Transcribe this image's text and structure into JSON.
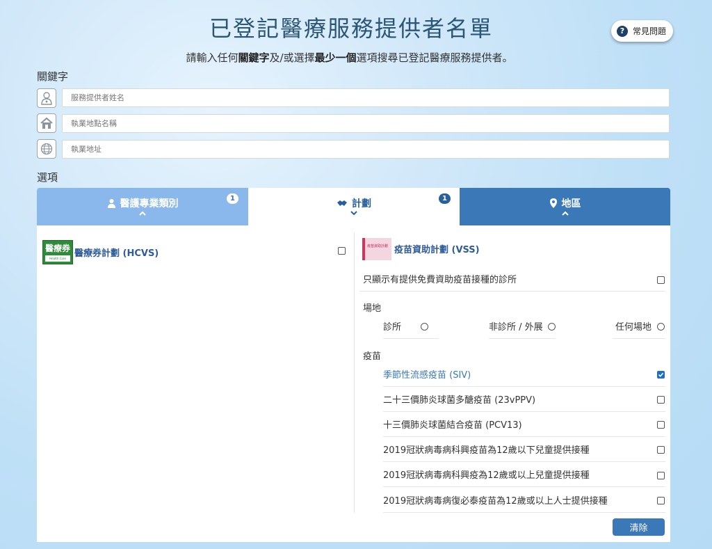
{
  "header": {
    "title": "已登記醫療服務提供者名單",
    "faq_label": "常見問題",
    "faq_icon": "?",
    "subtitle": {
      "part1": "請輸入任何",
      "bold1": "關鍵字",
      "part2": "及/或選擇",
      "bold2": "最少一個",
      "part3": "選項搜尋已登記醫療服務提供者。"
    }
  },
  "keyword": {
    "label": "關鍵字",
    "fields": [
      {
        "icon": "doctor-icon",
        "placeholder": "服務提供者姓名",
        "value": ""
      },
      {
        "icon": "home-icon",
        "placeholder": "執業地點名稱",
        "value": ""
      },
      {
        "icon": "globe-icon",
        "placeholder": "執業地址",
        "value": ""
      }
    ]
  },
  "options": {
    "label": "選項",
    "tabs": [
      {
        "label": "醫護專業類別",
        "count": "1",
        "icon": "nurse-icon",
        "active": false
      },
      {
        "label": "計劃",
        "count": "1",
        "icon": "handshake-icon",
        "active": true
      },
      {
        "label": "地區",
        "count": "",
        "icon": "map-pin-icon",
        "active": false
      }
    ]
  },
  "schemes": {
    "hcvs": {
      "logo_text": "醫療券",
      "logo_sub": "Health Care Voucher",
      "name": "醫療券計劃 (HCVS)",
      "checked": false
    },
    "vss": {
      "logo_text": "疫苗資助計劃",
      "name": "疫苗資助計劃 (VSS)",
      "free_only_label": "只顯示有提供免費資助疫苗接種的診所",
      "free_only_checked": false,
      "venue_label": "場地",
      "venues": [
        {
          "label": "診所",
          "selected": false
        },
        {
          "label": "非診所 / 外展",
          "selected": false
        },
        {
          "label": "任何場地",
          "selected": false
        }
      ],
      "vaccine_label": "疫苗",
      "vaccines": [
        {
          "label": "季節性流感疫苗 (SIV)",
          "checked": true
        },
        {
          "label": "二十三價肺炎球菌多醣疫苗 (23vPPV)",
          "checked": false
        },
        {
          "label": "十三價肺炎球菌結合疫苗 (PCV13)",
          "checked": false
        },
        {
          "label": "2019冠狀病毒病科興疫苗為12歲以下兒童提供接種",
          "checked": false
        },
        {
          "label": "2019冠狀病毒病科興疫為12歲或以上兒童提供接種",
          "checked": false
        },
        {
          "label": "2019冠狀病毒病復必泰疫苗為12歲或以上人士提供接種",
          "checked": false
        }
      ]
    }
  },
  "actions": {
    "clear_label": "清除"
  },
  "colors": {
    "primary": "#3a78b8",
    "tab_light": "#8bb8ec",
    "title": "#2a5674",
    "check": "#1a6fc9"
  }
}
